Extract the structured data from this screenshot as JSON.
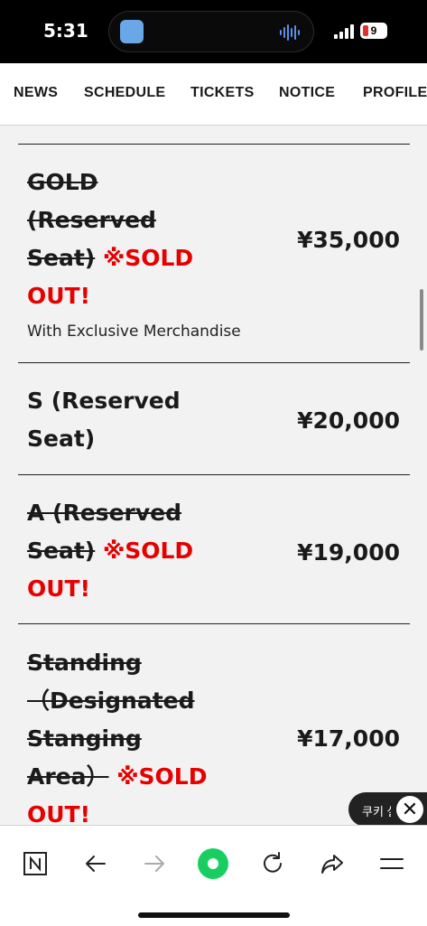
{
  "status_bar": {
    "time": "5:31",
    "battery": "9"
  },
  "nav": {
    "items": [
      "NEWS",
      "SCHEDULE",
      "TICKETS",
      "NOTICE",
      "PROFILE"
    ]
  },
  "tickets": [
    {
      "name_lines": [
        "GOLD",
        "(Reserved",
        "Seat)"
      ],
      "sold_out": "※SOLD OUT!",
      "note": "With Exclusive Merchandise",
      "price": "¥35,000"
    },
    {
      "name_lines": [
        "S (Reserved",
        "Seat)"
      ],
      "price": "¥20,000"
    },
    {
      "name_lines": [
        "A (Reserved",
        "Seat)"
      ],
      "sold_out": "※SOLD OUT!",
      "price": "¥19,000"
    },
    {
      "name_lines": [
        "Standing",
        "（Designated",
        "Stanging",
        "Area）"
      ],
      "sold_out": "※SOLD OUT!",
      "price": "¥17,000"
    }
  ],
  "cookie_popup": {
    "label": "쿠키 설정",
    "close": "✕"
  },
  "toolbar": {
    "icons": [
      "naver-n-icon",
      "back-arrow-icon",
      "forward-arrow-icon",
      "green-dot-icon",
      "reload-icon",
      "share-icon",
      "menu-icon"
    ]
  },
  "colors": {
    "sold_out": "#e60000",
    "accent_green": "#19ce60"
  }
}
